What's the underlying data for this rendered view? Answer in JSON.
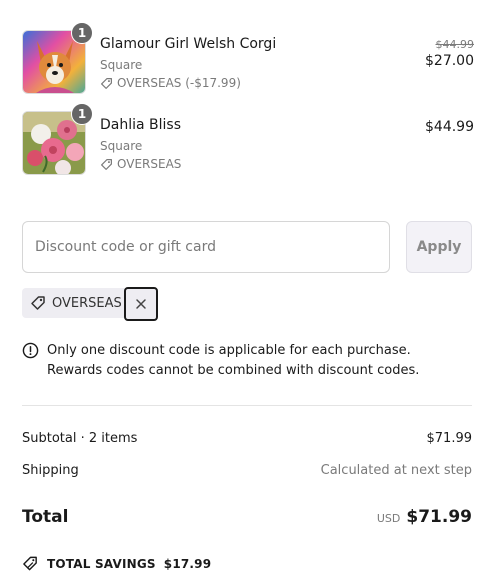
{
  "cart": {
    "items": [
      {
        "quantity": "1",
        "title": "Glamour Girl Welsh Corgi",
        "variant": "Square",
        "discount_label": "OVERSEAS (-$17.99)",
        "original_price": "$44.99",
        "price": "$27.00"
      },
      {
        "quantity": "1",
        "title": "Dahlia Bliss",
        "variant": "Square",
        "discount_label": "OVERSEAS",
        "original_price": "",
        "price": "$44.99"
      }
    ]
  },
  "discount": {
    "placeholder": "Discount code or gift card",
    "value": "",
    "apply_label": "Apply",
    "applied_code": "OVERSEAS"
  },
  "notice": {
    "line1": "Only one discount code is applicable for each purchase.",
    "line2": "Rewards codes cannot be combined with discount codes."
  },
  "summary": {
    "subtotal_label": "Subtotal · 2 items",
    "subtotal_value": "$71.99",
    "shipping_label": "Shipping",
    "shipping_value": "Calculated at next step",
    "total_label": "Total",
    "currency": "USD",
    "total_value": "$71.99",
    "savings_label": "TOTAL SAVINGS",
    "savings_value": "$17.99"
  },
  "icons": {
    "tag": "tag-icon",
    "remove": "close-icon",
    "info": "info-icon",
    "savings": "tags-icon"
  },
  "colors": {
    "text": "#1a1a1a",
    "muted": "#7a7a7a",
    "badge": "#666666",
    "chip_bg": "#eeedf2",
    "apply_bg": "#f3f2f7"
  }
}
